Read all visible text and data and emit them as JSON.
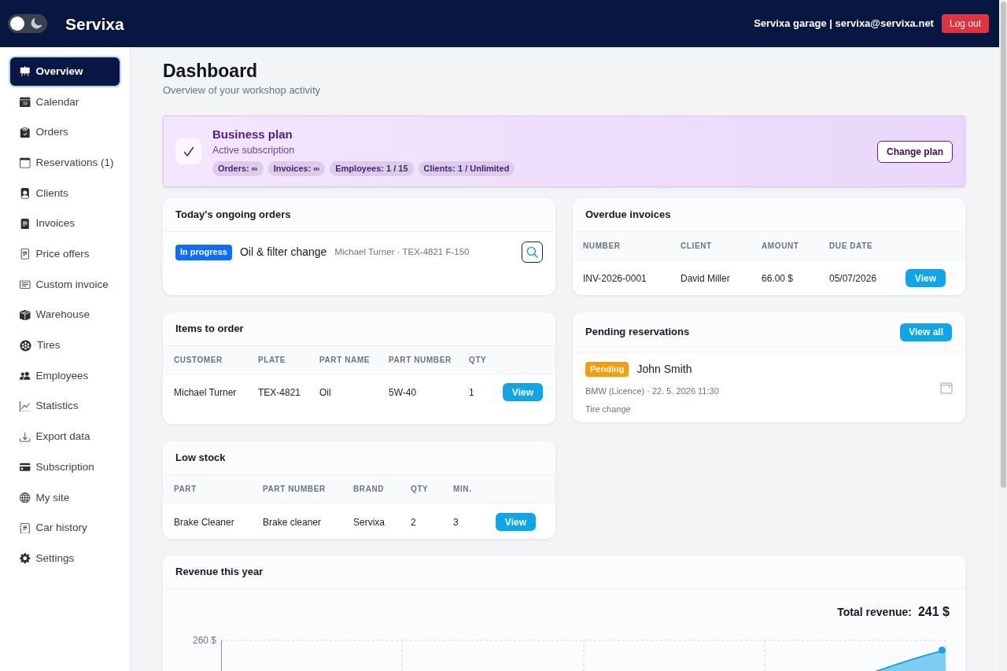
{
  "header": {
    "theme_toggle": {
      "on": false
    },
    "brand": "Servixa",
    "account": "Servixa garage | servixa@servixa.net",
    "logout_button": "Log out"
  },
  "sidebar": {
    "items": [
      {
        "label": "Overview",
        "selected": true
      },
      {
        "label": "Calendar",
        "selected": false
      },
      {
        "label": "Orders",
        "selected": false
      },
      {
        "label": "Reservations (1)",
        "selected": false
      },
      {
        "label": "Clients",
        "selected": false
      },
      {
        "label": "Invoices",
        "selected": false
      },
      {
        "label": "Price offers",
        "selected": false
      },
      {
        "label": "Custom invoice",
        "selected": false
      },
      {
        "label": "Warehouse",
        "selected": false
      },
      {
        "label": "Tires",
        "selected": false
      },
      {
        "label": "Employees",
        "selected": false
      },
      {
        "label": "Statistics",
        "selected": false
      },
      {
        "label": "Export data",
        "selected": false
      },
      {
        "label": "Subscription",
        "selected": false
      },
      {
        "label": "My site",
        "selected": false
      },
      {
        "label": "Car history",
        "selected": false
      },
      {
        "label": "Settings",
        "selected": false
      }
    ]
  },
  "page": {
    "title": "Dashboard",
    "subtitle": "Overview of your workshop activity"
  },
  "plan": {
    "title": "Business plan",
    "status": "Active subscription",
    "limits": [
      "Orders: ∞",
      "Invoices: ∞",
      "Employees: 1 / 15",
      "Clients: 1 / Unlimited"
    ],
    "button": "Change plan"
  },
  "ongoing_orders": {
    "title": "Today's ongoing orders",
    "orders": [
      {
        "status": "In progress",
        "service": "Oil & filter change",
        "details": "Michael Turner · TEX-4821 F-150"
      }
    ]
  },
  "overdue_invoices": {
    "title": "Overdue invoices",
    "columns": [
      "NUMBER",
      "CLIENT",
      "AMOUNT",
      "DUE DATE"
    ],
    "rows": [
      {
        "cells": [
          "INV-2026-0001",
          "David Miller",
          "66.00 $",
          "05/07/2026"
        ],
        "button": "View"
      }
    ]
  },
  "items_to_order": {
    "title": "Items to order",
    "columns": [
      "CUSTOMER",
      "PLATE",
      "PART NAME",
      "PART NUMBER",
      "QTY"
    ],
    "rows": [
      {
        "cells": [
          "Michael Turner",
          "TEX-4821",
          "Oil",
          "5W-40",
          "1"
        ],
        "button": "View"
      }
    ]
  },
  "pending_reservations": {
    "title": "Pending reservations",
    "button": "View all",
    "reservations": [
      {
        "status": "Pending",
        "name": "John Smith",
        "details": "BMW (Licence) · 22. 5. 2026 11:30",
        "service": "Tire change"
      }
    ]
  },
  "low_stock": {
    "title": "Low stock",
    "columns": [
      "PART",
      "PART NUMBER",
      "BRAND",
      "QTY",
      "MIN."
    ],
    "rows": [
      {
        "cells": [
          "Brake Cleaner",
          "Brake cleaner",
          "Servixa",
          "2",
          "3"
        ],
        "button": "View"
      }
    ]
  },
  "revenue": {
    "title": "Revenue this year",
    "total_label": "Total revenue:",
    "total": "241 $",
    "axis_label": "260 $"
  }
}
